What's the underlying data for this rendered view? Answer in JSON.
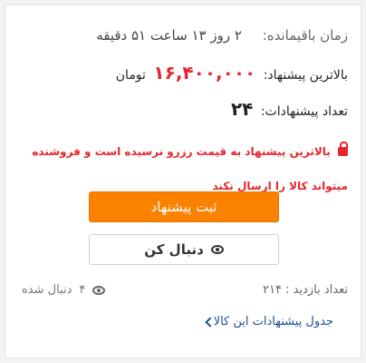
{
  "remaining": {
    "label": "زمان باقیمانده:",
    "value": "۲ روز ۱۳ ساعت ۵۱ دقیقه"
  },
  "highest_bid": {
    "label": "بالاترین پیشنهاد:",
    "amount": "۱۶,۴۰۰,۰۰۰",
    "currency": "تومان"
  },
  "bids_count": {
    "label": "تعداد پیشنهادات:",
    "value": "۲۴"
  },
  "warning": {
    "text": "بالاترین پیشنهاد به قیمت رزرو نرسیده است و فروشنده میتواند کالا را ارسال نکند",
    "icon": "lock-icon",
    "color": "#e3262c"
  },
  "buttons": {
    "submit_bid": "ثبت پیشنهاد",
    "follow": "دنبال کن"
  },
  "stats": {
    "visits_label": "تعداد بازدید :",
    "visits_value": "۲۱۴",
    "followers_value": "۴",
    "followers_label": "دنبال شده"
  },
  "links": {
    "bids_table": "جدول پیشنهادات این کالا"
  },
  "colors": {
    "accent": "#fb8200",
    "price": "#e3262c",
    "link": "#1d4f91"
  }
}
